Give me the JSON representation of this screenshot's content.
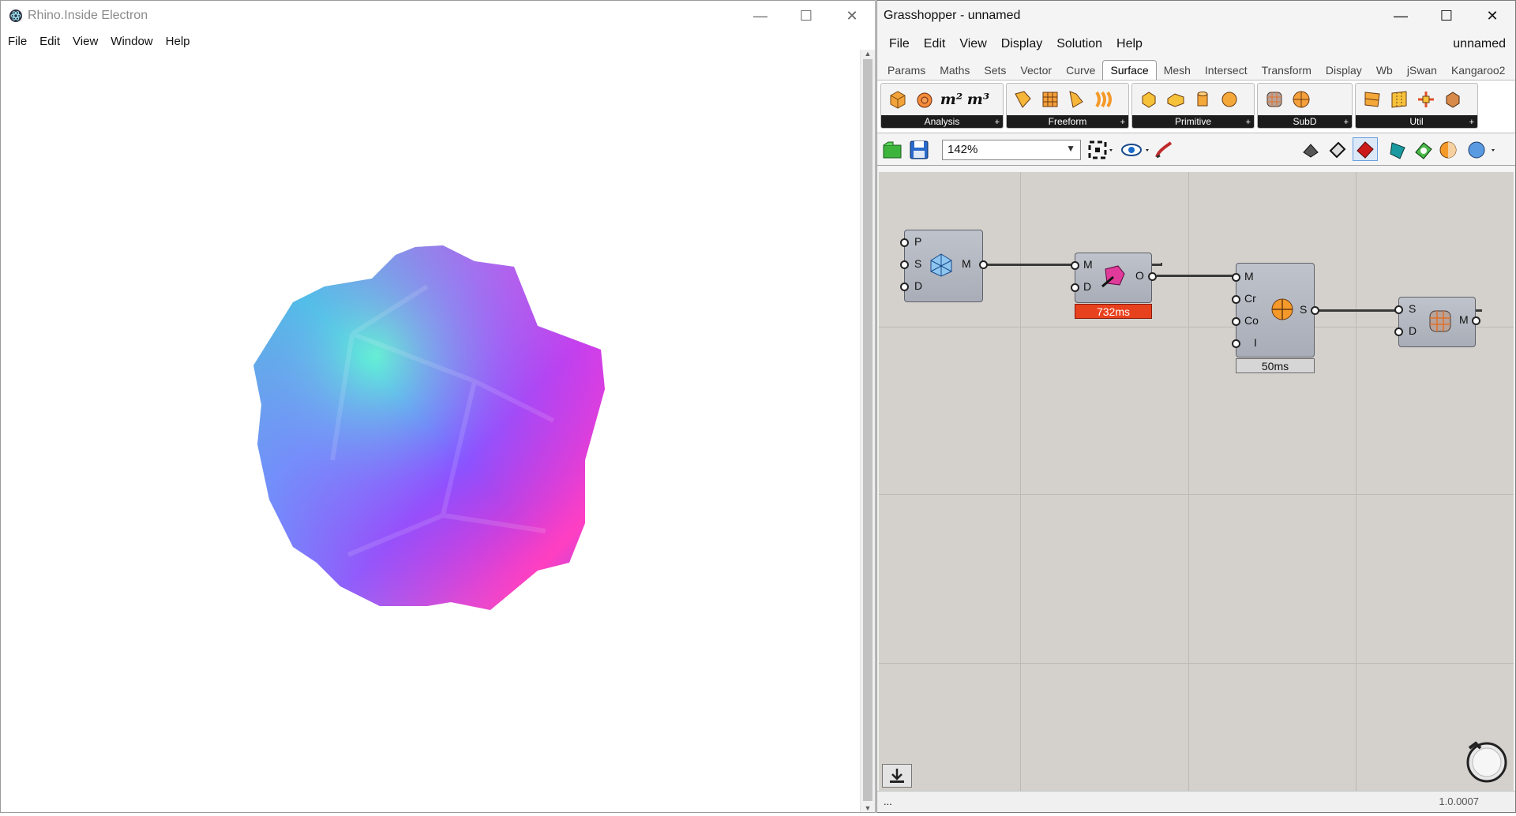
{
  "left_window": {
    "title": "Rhino.Inside Electron",
    "controls": {
      "minimize": "—",
      "maximize": "☐",
      "close": "✕"
    },
    "menu": [
      "File",
      "Edit",
      "View",
      "Window",
      "Help"
    ]
  },
  "grasshopper": {
    "title": "Grasshopper - unnamed",
    "controls": {
      "minimize": "—",
      "maximize": "☐",
      "close": "✕"
    },
    "menu": [
      "File",
      "Edit",
      "View",
      "Display",
      "Solution",
      "Help"
    ],
    "document_name": "unnamed",
    "tabs": [
      "Params",
      "Maths",
      "Sets",
      "Vector",
      "Curve",
      "Surface",
      "Mesh",
      "Intersect",
      "Transform",
      "Display",
      "Wb",
      "jSwan",
      "Kangaroo2"
    ],
    "active_tab": "Surface",
    "panels": [
      "Analysis",
      "Freeform",
      "Primitive",
      "SubD",
      "Util"
    ],
    "analysis_labels": [
      "m²",
      "m³"
    ],
    "zoom": "142%",
    "nodes": {
      "mesh_sphere": {
        "inputs": [
          "P",
          "S",
          "D"
        ],
        "outputs": [
          "M"
        ]
      },
      "mesh_deform": {
        "inputs": [
          "M",
          "D"
        ],
        "outputs": [
          "O"
        ],
        "timing": "732ms"
      },
      "subd_from_mesh": {
        "inputs": [
          "M",
          "Cr",
          "Co",
          "I"
        ],
        "outputs": [
          "S"
        ],
        "timing": "50ms"
      },
      "mesh_from_subd": {
        "inputs": [
          "S",
          "D"
        ],
        "outputs": [
          "M"
        ]
      }
    },
    "status_left": "...",
    "version": "1.0.0007",
    "colors": {
      "timing_error": "#e8411d",
      "timing_ok": "#d6d6d6"
    }
  }
}
